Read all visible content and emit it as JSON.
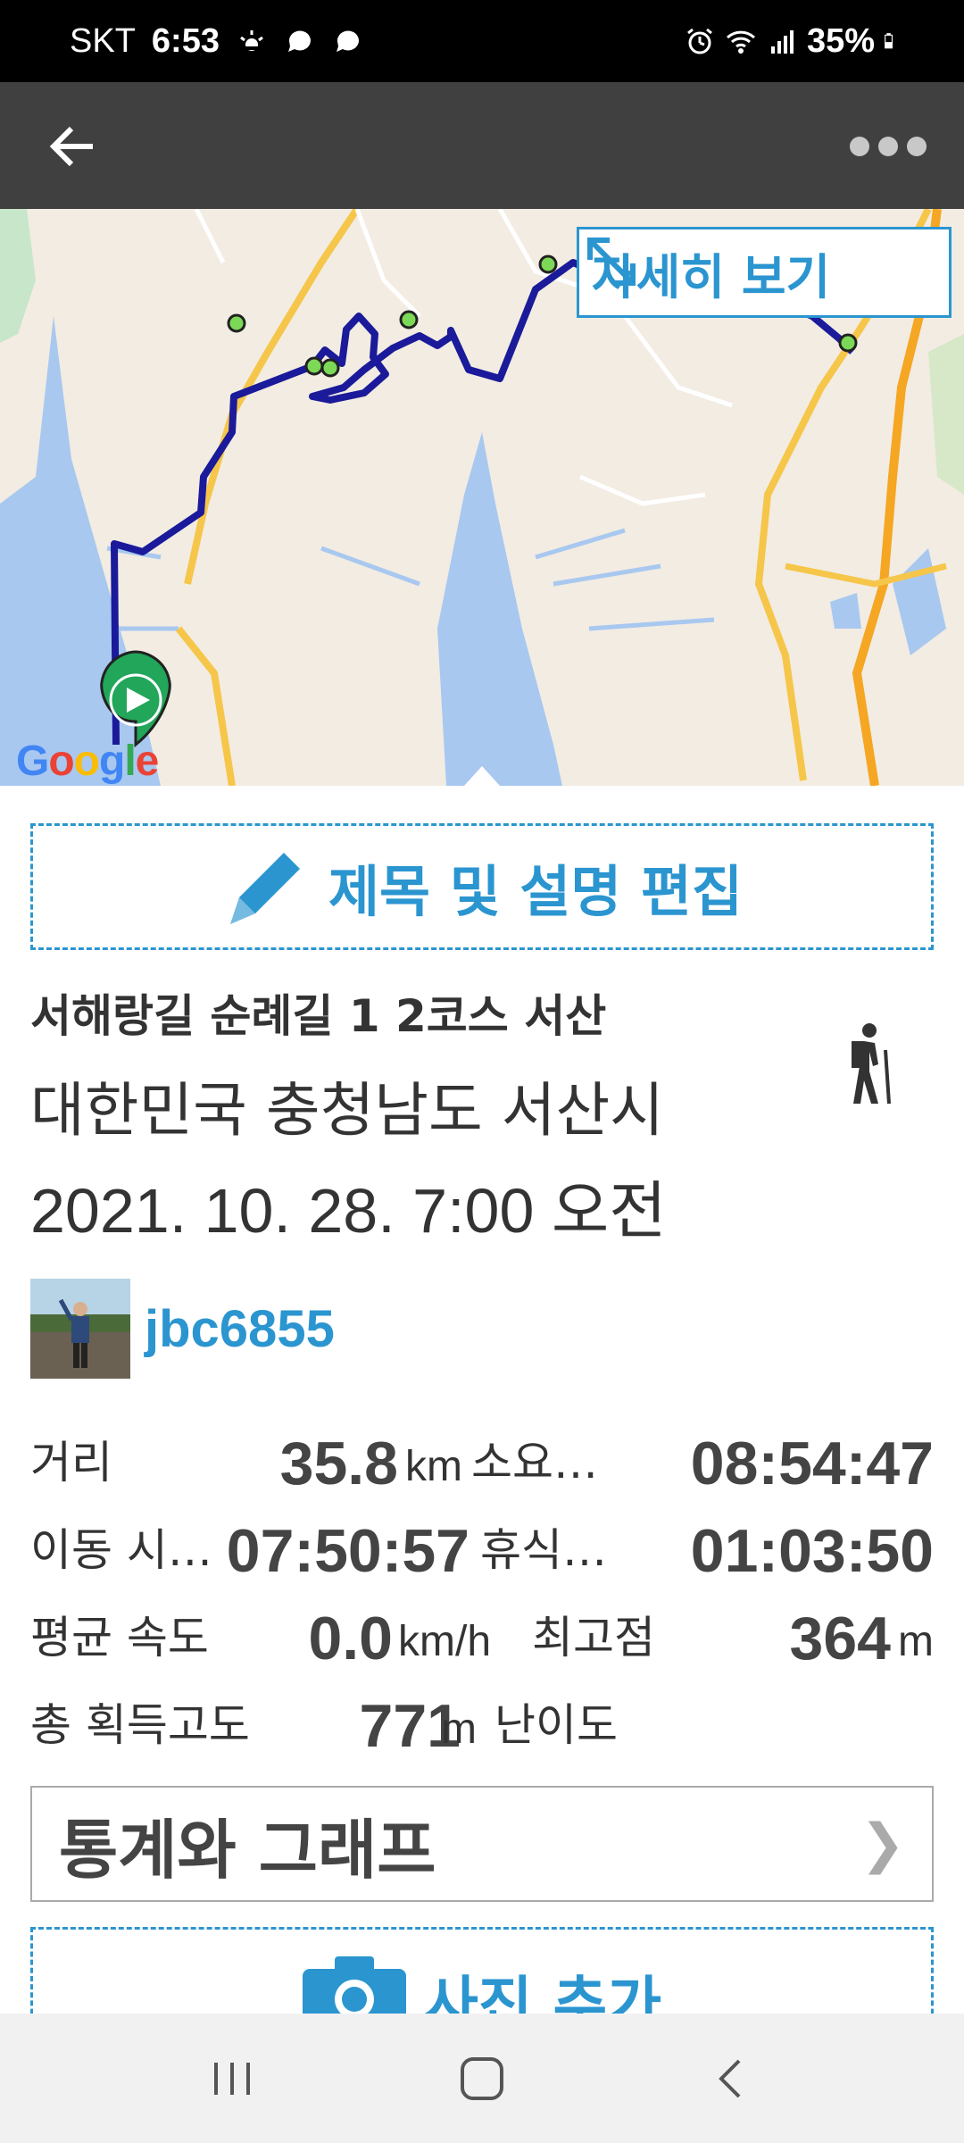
{
  "status_bar": {
    "carrier": "SKT",
    "time": "6:53",
    "battery": "35%"
  },
  "map": {
    "detail_label": "자세히 보기",
    "google_logo": "Google"
  },
  "activity": {
    "edit_label": "제목 및 설명 편집",
    "route_name": "서해랑길 순례길 1 2코스 서산",
    "location": "대한민국 충청남도 서산시",
    "datetime": "2021. 10. 28. 7:00 오전",
    "type_icon": "hiking-icon",
    "username": "jbc6855"
  },
  "stats": {
    "distance_label": "거리",
    "distance_value": "35.8",
    "distance_unit": "km",
    "duration_label": "소요…",
    "duration_value": "08:54:47",
    "moving_label": "이동 시…",
    "moving_value": "07:50:57",
    "rest_label": "휴식…",
    "rest_value": "01:03:50",
    "avg_speed_label": "평균 속도",
    "avg_speed_value": "0.0",
    "avg_speed_unit": "km/h",
    "max_alt_label": "최고점",
    "max_alt_value": "364",
    "max_alt_unit": "m",
    "elev_gain_label": "총 획득고도",
    "elev_gain_value": "771",
    "elev_gain_unit": "m",
    "difficulty_label": "난이도"
  },
  "buttons": {
    "stats_graph_label": "통계와 그래프",
    "add_photo_label": "사진 추가"
  },
  "colors": {
    "accent": "#2b95d0",
    "route": "#1a1a9a",
    "app_bar": "#404040"
  }
}
